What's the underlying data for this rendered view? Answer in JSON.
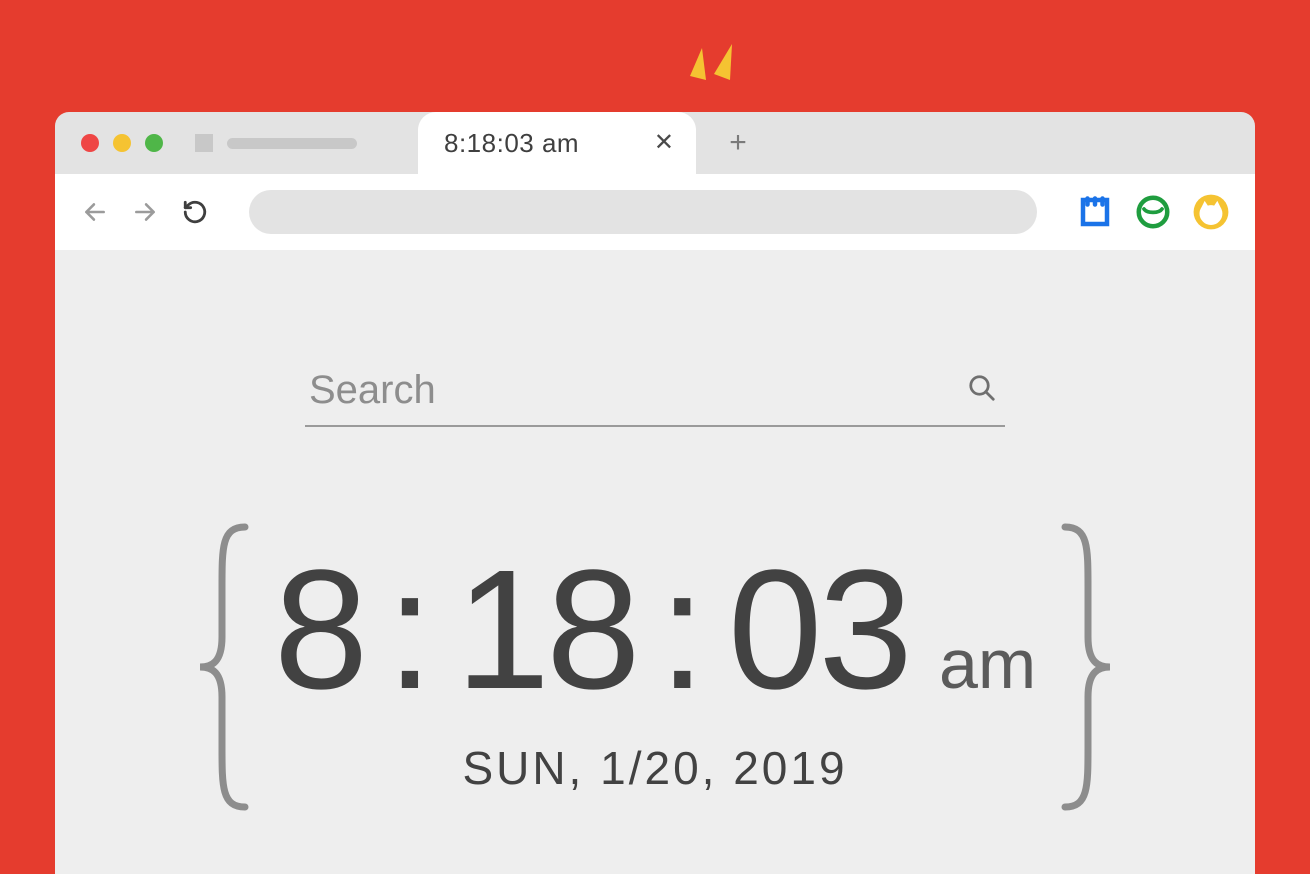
{
  "tab": {
    "title": "8:18:03 am"
  },
  "search": {
    "placeholder": "Search"
  },
  "clock": {
    "hours": "8",
    "minutes": "18",
    "seconds": "03",
    "ampm": "am",
    "date": "SUN, 1/20, 2019"
  },
  "icons": {
    "ext1": "bookmark-icon",
    "ext2": "clock-icon",
    "ext3": "cat-icon"
  }
}
